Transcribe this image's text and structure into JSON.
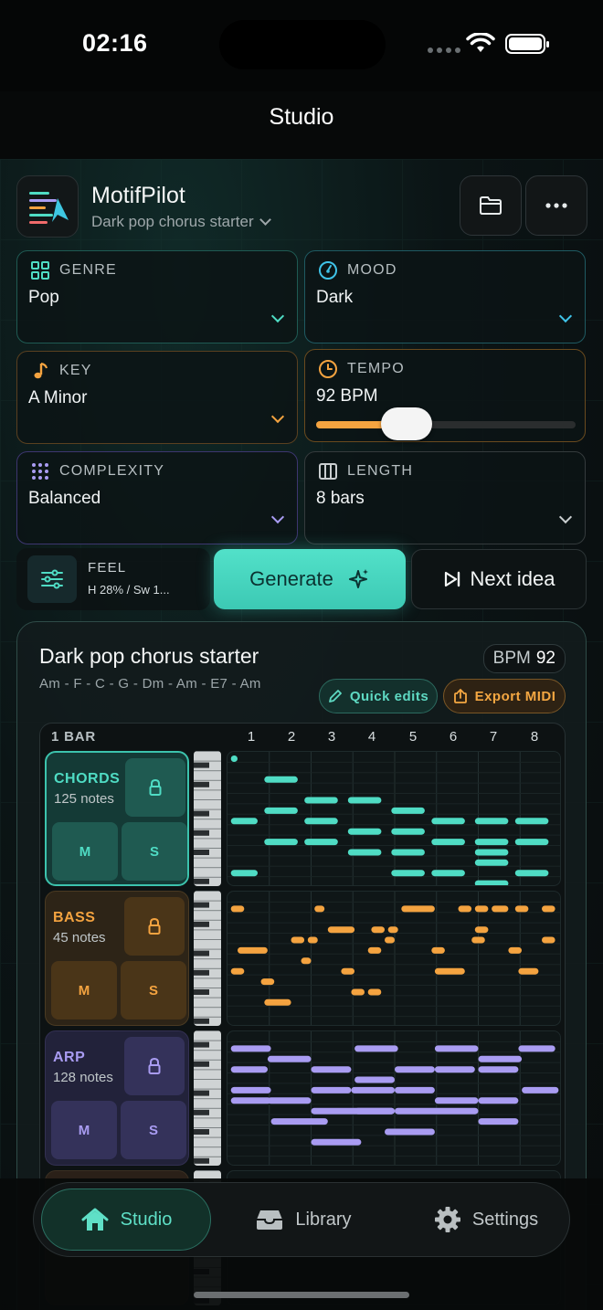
{
  "status": {
    "time": "02:16"
  },
  "nav": {
    "title": "Studio"
  },
  "header": {
    "app_name": "MotifPilot",
    "preset": "Dark pop chorus starter",
    "icons": [
      "folder-icon",
      "more-icon"
    ]
  },
  "colors": {
    "teal": "#4fdcc4",
    "orange": "#f4a340",
    "purple": "#a99cf2"
  },
  "params": {
    "genre": {
      "label": "GENRE",
      "value": "Pop"
    },
    "mood": {
      "label": "MOOD",
      "value": "Dark"
    },
    "key": {
      "label": "KEY",
      "value": "A Minor"
    },
    "tempo": {
      "label": "TEMPO",
      "value": "92 BPM",
      "slider_fraction": 0.35
    },
    "complexity": {
      "label": "COMPLEXITY",
      "value": "Balanced"
    },
    "length": {
      "label": "LENGTH",
      "value": "8 bars"
    }
  },
  "feel": {
    "label": "FEEL",
    "value": "H 28% / Sw 1..."
  },
  "actions": {
    "generate": "Generate",
    "next": "Next idea"
  },
  "result": {
    "title": "Dark pop chorus starter",
    "progression": "Am - F - C - G - Dm - Am - E7 - Am",
    "bpm_label": "BPM",
    "bpm_value": "92",
    "quick_edits": "Quick edits",
    "export": "Export MIDI"
  },
  "grid": {
    "bar_label": "1 BAR",
    "bars": [
      "1",
      "2",
      "3",
      "4",
      "5",
      "6",
      "7",
      "8"
    ]
  },
  "tracks": [
    {
      "name": "CHORDS",
      "notes": "125 notes",
      "mute": "M",
      "solo": "S",
      "pattern": [
        [
          0.01,
          0.03,
          0
        ],
        [
          0.11,
          0.21,
          2
        ],
        [
          0.23,
          0.33,
          4
        ],
        [
          0.36,
          0.46,
          4
        ],
        [
          0.49,
          0.59,
          5
        ],
        [
          0.01,
          0.09,
          6
        ],
        [
          0.11,
          0.21,
          5
        ],
        [
          0.23,
          0.33,
          6
        ],
        [
          0.36,
          0.46,
          7
        ],
        [
          0.49,
          0.59,
          7
        ],
        [
          0.61,
          0.71,
          6
        ],
        [
          0.74,
          0.84,
          6
        ],
        [
          0.86,
          0.96,
          6
        ],
        [
          0.11,
          0.21,
          8
        ],
        [
          0.23,
          0.33,
          8
        ],
        [
          0.36,
          0.46,
          9
        ],
        [
          0.49,
          0.59,
          9
        ],
        [
          0.61,
          0.71,
          8
        ],
        [
          0.74,
          0.84,
          8
        ],
        [
          0.86,
          0.96,
          8
        ],
        [
          0.74,
          0.84,
          9
        ],
        [
          0.74,
          0.84,
          10
        ],
        [
          0.01,
          0.09,
          11
        ],
        [
          0.49,
          0.59,
          11
        ],
        [
          0.61,
          0.71,
          11
        ],
        [
          0.74,
          0.84,
          12
        ],
        [
          0.86,
          0.96,
          11
        ]
      ]
    },
    {
      "name": "BASS",
      "notes": "45 notes",
      "mute": "M",
      "solo": "S",
      "pattern": [
        [
          0.01,
          0.05,
          1
        ],
        [
          0.26,
          0.29,
          1
        ],
        [
          0.52,
          0.62,
          1
        ],
        [
          0.69,
          0.73,
          1
        ],
        [
          0.74,
          0.78,
          1
        ],
        [
          0.79,
          0.84,
          1
        ],
        [
          0.86,
          0.9,
          1
        ],
        [
          0.94,
          0.98,
          1
        ],
        [
          0.3,
          0.38,
          3
        ],
        [
          0.43,
          0.47,
          3
        ],
        [
          0.48,
          0.51,
          3
        ],
        [
          0.74,
          0.78,
          3
        ],
        [
          0.19,
          0.23,
          4
        ],
        [
          0.24,
          0.27,
          4
        ],
        [
          0.47,
          0.5,
          4
        ],
        [
          0.73,
          0.77,
          4
        ],
        [
          0.94,
          0.98,
          4
        ],
        [
          0.03,
          0.12,
          5
        ],
        [
          0.42,
          0.46,
          5
        ],
        [
          0.61,
          0.65,
          5
        ],
        [
          0.84,
          0.88,
          5
        ],
        [
          0.22,
          0.25,
          6
        ],
        [
          0.62,
          0.71,
          7
        ],
        [
          0.34,
          0.38,
          7
        ],
        [
          0.01,
          0.05,
          7
        ],
        [
          0.87,
          0.93,
          7
        ],
        [
          0.1,
          0.14,
          8
        ],
        [
          0.37,
          0.41,
          9
        ],
        [
          0.42,
          0.46,
          9
        ],
        [
          0.11,
          0.19,
          10
        ]
      ]
    },
    {
      "name": "ARP",
      "notes": "128 notes",
      "mute": "M",
      "solo": "S",
      "pattern": [
        [
          0.01,
          0.13,
          1
        ],
        [
          0.38,
          0.51,
          1
        ],
        [
          0.62,
          0.75,
          1
        ],
        [
          0.87,
          0.98,
          1
        ],
        [
          0.12,
          0.25,
          2
        ],
        [
          0.75,
          0.88,
          2
        ],
        [
          0.01,
          0.12,
          3
        ],
        [
          0.25,
          0.37,
          3
        ],
        [
          0.5,
          0.62,
          3
        ],
        [
          0.62,
          0.74,
          3
        ],
        [
          0.75,
          0.87,
          3
        ],
        [
          0.38,
          0.5,
          4
        ],
        [
          0.01,
          0.13,
          5
        ],
        [
          0.25,
          0.37,
          5
        ],
        [
          0.75,
          0.87,
          6
        ],
        [
          0.12,
          0.25,
          6
        ],
        [
          0.5,
          0.62,
          5
        ],
        [
          0.88,
          0.99,
          5
        ],
        [
          0.13,
          0.3,
          8
        ],
        [
          0.38,
          0.5,
          7
        ],
        [
          0.25,
          0.5,
          7
        ],
        [
          0.5,
          0.75,
          7
        ],
        [
          0.62,
          0.75,
          6
        ],
        [
          0.01,
          0.13,
          6
        ],
        [
          0.75,
          0.87,
          8
        ],
        [
          0.25,
          0.4,
          10
        ],
        [
          0.47,
          0.62,
          9
        ],
        [
          0.37,
          0.5,
          5
        ]
      ]
    }
  ],
  "tabbar": {
    "studio": "Studio",
    "library": "Library",
    "settings": "Settings"
  }
}
